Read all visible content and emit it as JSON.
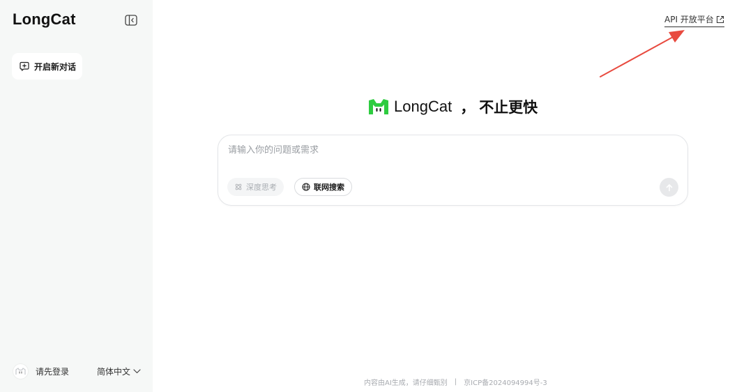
{
  "sidebar": {
    "brand": "LongCat",
    "new_chat_label": "开启新对话",
    "login_label": "请先登录",
    "language_label": "简体中文"
  },
  "header": {
    "api_link_label": "API 开放平台"
  },
  "hero": {
    "brand": "LongCat",
    "separator": "，",
    "tagline": "不止更快"
  },
  "composer": {
    "placeholder": "请输入你的问题或需求",
    "deep_think_label": "深度思考",
    "web_search_label": "联网搜索"
  },
  "footer": {
    "disclaimer": "内容由AI生成，请仔细甄别",
    "divider": "|",
    "icp": "京ICP备2024094994号-3"
  },
  "colors": {
    "sidebar_bg": "#f6f8f7",
    "brand_green": "#2ecc40",
    "annotation_arrow": "#e84a3f"
  }
}
